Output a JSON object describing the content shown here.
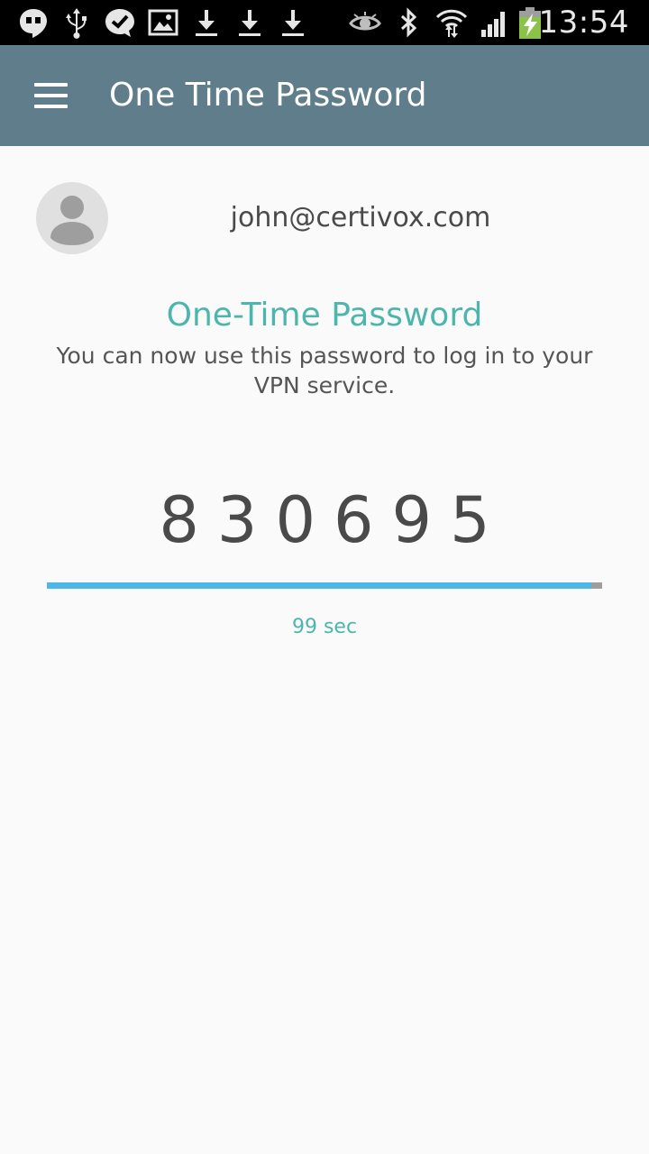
{
  "status_bar": {
    "time": "13:54",
    "left_icons": [
      "hangouts-icon",
      "usb-icon",
      "check-bubble-icon",
      "image-icon",
      "download-icon",
      "download-icon",
      "download-icon"
    ],
    "right_icons": [
      "eye-icon",
      "bluetooth-icon",
      "wifi-icon",
      "signal-icon",
      "battery-charging-icon"
    ]
  },
  "app_bar": {
    "title": "One Time Password",
    "background_color": "#607d8b",
    "menu_icon": "hamburger-menu-icon"
  },
  "account": {
    "email": "john@certivox.com",
    "avatar_icon": "person-avatar-icon"
  },
  "otp": {
    "heading": "One-Time Password",
    "description": "You can now use this password to log in to your VPN service.",
    "code": "830695",
    "countdown": "99 sec",
    "progress_fraction": 0.98,
    "accent_color": "#4db6ac",
    "progress_color": "#4db8e6"
  }
}
